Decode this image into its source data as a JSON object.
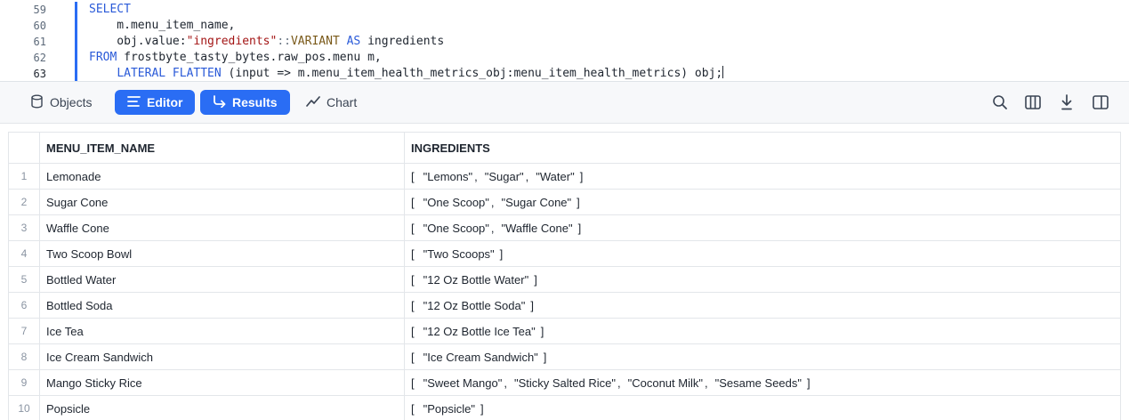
{
  "editor": {
    "lines": [
      {
        "num": "59",
        "parts": [
          {
            "t": "SELECT",
            "c": "kw"
          }
        ]
      },
      {
        "num": "60",
        "parts": [
          {
            "t": "    m.menu_item_name,",
            "c": ""
          }
        ]
      },
      {
        "num": "61",
        "parts": [
          {
            "t": "    obj.value:",
            "c": ""
          },
          {
            "t": "\"ingredients\"",
            "c": "str"
          },
          {
            "t": "::",
            "c": "op"
          },
          {
            "t": "VARIANT",
            "c": "typ"
          },
          {
            "t": " ",
            "c": ""
          },
          {
            "t": "AS",
            "c": "kw"
          },
          {
            "t": " ingredients",
            "c": ""
          }
        ]
      },
      {
        "num": "62",
        "parts": [
          {
            "t": "FROM",
            "c": "kw"
          },
          {
            "t": " frostbyte_tasty_bytes.raw_pos.menu m,",
            "c": ""
          }
        ]
      },
      {
        "num": "63",
        "parts": [
          {
            "t": "    ",
            "c": ""
          },
          {
            "t": "LATERAL FLATTEN",
            "c": "kw"
          },
          {
            "t": " (input => m.menu_item_health_metrics_obj:menu_item_health_metrics) obj;",
            "c": ""
          }
        ],
        "caret": true
      }
    ]
  },
  "toolbar": {
    "objects_label": "Objects",
    "editor_label": "Editor",
    "results_label": "Results",
    "chart_label": "Chart",
    "icons": [
      "search-icon",
      "columns-icon",
      "download-icon",
      "split-panel-icon"
    ]
  },
  "results": {
    "columns": [
      "MENU_ITEM_NAME",
      "INGREDIENTS"
    ],
    "rows": [
      {
        "n": "1",
        "name": "Lemonade",
        "ingredients": [
          "\"Lemons\"",
          "\"Sugar\"",
          "\"Water\""
        ]
      },
      {
        "n": "2",
        "name": "Sugar Cone",
        "ingredients": [
          "\"One Scoop\"",
          "\"Sugar Cone\""
        ]
      },
      {
        "n": "3",
        "name": "Waffle Cone",
        "ingredients": [
          "\"One Scoop\"",
          "\"Waffle Cone\""
        ]
      },
      {
        "n": "4",
        "name": "Two Scoop Bowl",
        "ingredients": [
          "\"Two Scoops\""
        ]
      },
      {
        "n": "5",
        "name": "Bottled Water",
        "ingredients": [
          "\"12 Oz Bottle Water\""
        ]
      },
      {
        "n": "6",
        "name": "Bottled Soda",
        "ingredients": [
          "\"12 Oz Bottle Soda\""
        ]
      },
      {
        "n": "7",
        "name": "Ice Tea",
        "ingredients": [
          "\"12 Oz Bottle Ice Tea\""
        ]
      },
      {
        "n": "8",
        "name": "Ice Cream Sandwich",
        "ingredients": [
          "\"Ice Cream Sandwich\""
        ]
      },
      {
        "n": "9",
        "name": "Mango Sticky Rice",
        "ingredients": [
          "\"Sweet Mango\"",
          "\"Sticky Salted Rice\"",
          "\"Coconut Milk\"",
          "\"Sesame Seeds\""
        ]
      },
      {
        "n": "10",
        "name": "Popsicle",
        "ingredients": [
          "\"Popsicle\""
        ]
      }
    ]
  },
  "colors": {
    "accent": "#2a6df4",
    "keyword": "#2a5ad8",
    "string": "#a31515"
  }
}
